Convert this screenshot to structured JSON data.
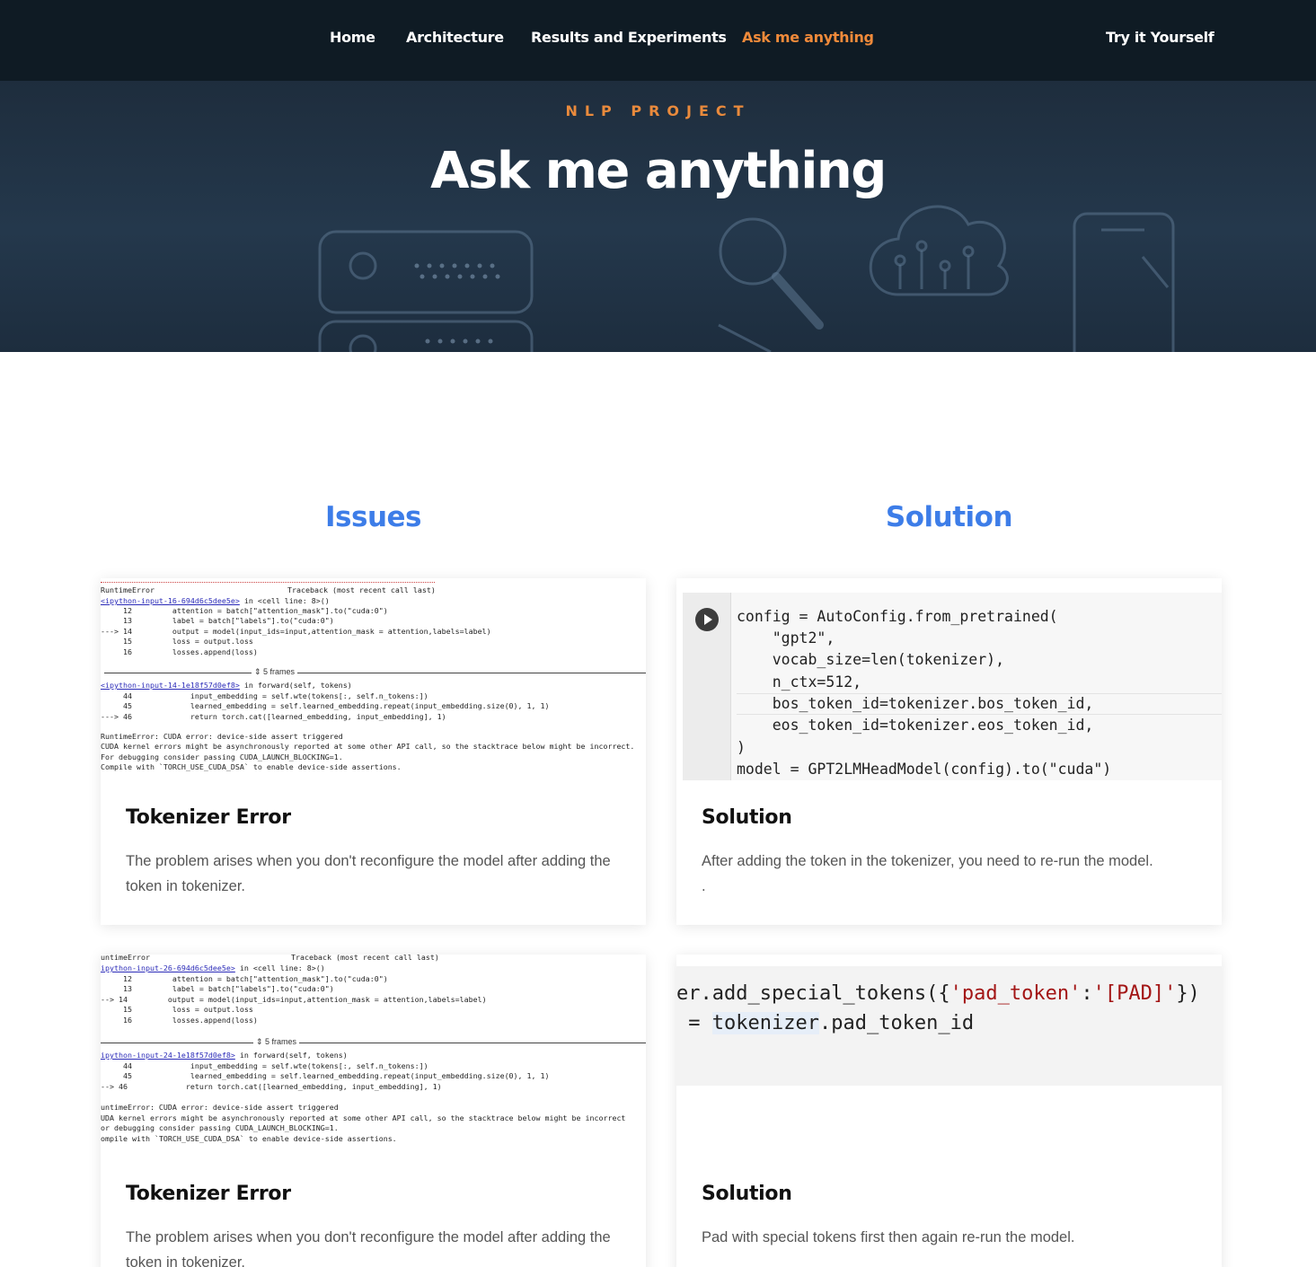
{
  "nav": {
    "links": [
      {
        "label": "Home"
      },
      {
        "label": "Architecture"
      },
      {
        "label": "Results and Experiments"
      },
      {
        "label": "Ask me anything"
      }
    ],
    "cta": "Try it Yourself",
    "active_color": "#f08a3a"
  },
  "hero": {
    "eyebrow": "NLP PROJECT",
    "title": "Ask me anything",
    "decor_icons": [
      "server-icon",
      "magnifier-icon",
      "cloud-circuit-icon",
      "smartphone-icon"
    ]
  },
  "columns": {
    "left_heading": "Issues",
    "right_heading": "Solution",
    "heading_color": "#3d7de8"
  },
  "cards": [
    {
      "title": "Tokenizer Error",
      "text": "The problem arises when you don't reconfigure the model after adding the token in tokenizer.",
      "traceback": {
        "header_left": "RuntimeError",
        "header_right": "Traceback (most recent call last)",
        "frame1_link": "<ipython-input-16-694d6c5dee5e>",
        "frame1_rest": " in <cell line: 8>()",
        "frame1_lines": [
          "     12         attention = batch[\"attention_mask\"].to(\"cuda:0\")",
          "     13         label = batch[\"labels\"].to(\"cuda:0\")",
          "---> 14         output = model(input_ids=input,attention_mask = attention,labels=label)",
          "     15         loss = output.loss",
          "     16         losses.append(loss)"
        ],
        "frames": "5 frames",
        "frame2_link": "<ipython-input-14-1e18f57d0ef8>",
        "frame2_rest": " in forward(self, tokens)",
        "frame2_lines": [
          "     44             input_embedding = self.wte(tokens[:, self.n_tokens:])",
          "     45             learned_embedding = self.learned_embedding.repeat(input_embedding.size(0), 1, 1)",
          "---> 46             return torch.cat([learned_embedding, input_embedding], 1)"
        ],
        "error_lines": [
          "RuntimeError: CUDA error: device-side assert triggered",
          "CUDA kernel errors might be asynchronously reported at some other API call, so the stacktrace below might be incorrect.",
          "For debugging consider passing CUDA_LAUNCH_BLOCKING=1.",
          "Compile with `TORCH_USE_CUDA_DSA` to enable device-side assertions."
        ]
      }
    },
    {
      "title": "Solution",
      "text": "After adding the token in the tokenizer, you need to re-run the model.",
      "text2": ".",
      "code_lines": [
        "config = AutoConfig.from_pretrained(",
        "    \"gpt2\",",
        "    vocab_size=len(tokenizer),",
        "    n_ctx=512,",
        "    bos_token_id=tokenizer.bos_token_id,",
        "    eos_token_id=tokenizer.eos_token_id,",
        ")",
        "model = GPT2LMHeadModel(config).to(\"cuda\")"
      ]
    },
    {
      "title": "Tokenizer Error",
      "text": "The problem arises when you don't reconfigure the model after adding the token in tokenizer.",
      "traceback": {
        "header_left": "untimeError",
        "header_right": "Traceback (most recent call last)",
        "frame1_link": "ipython-input-26-694d6c5dee5e>",
        "frame1_rest": " in <cell line: 8>()",
        "frame1_lines": [
          "     12         attention = batch[\"attention_mask\"].to(\"cuda:0\")",
          "     13         label = batch[\"labels\"].to(\"cuda:0\")",
          "--> 14         output = model(input_ids=input,attention_mask = attention,labels=label)",
          "     15         loss = output.loss",
          "     16         losses.append(loss)"
        ],
        "frames": "5 frames",
        "frame2_link": "ipython-input-24-1e18f57d0ef8>",
        "frame2_rest": " in forward(self, tokens)",
        "frame2_lines": [
          "     44             input_embedding = self.wte(tokens[:, self.n_tokens:])",
          "     45             learned_embedding = self.learned_embedding.repeat(input_embedding.size(0), 1, 1)",
          "--> 46             return torch.cat([learned_embedding, input_embedding], 1)"
        ],
        "error_lines": [
          "untimeError: CUDA error: device-side assert triggered",
          "UDA kernel errors might be asynchronously reported at some other API call, so the stacktrace below might be incorrect",
          "or debugging consider passing CUDA_LAUNCH_BLOCKING=1.",
          "ompile with `TORCH_USE_CUDA_DSA` to enable device-side assertions."
        ]
      }
    },
    {
      "title": "Solution",
      "text": "Pad with special tokens first then again re-run the model.",
      "code_line1_a": "er.add_special_tokens({",
      "code_line1_s1": "'pad_token'",
      "code_line1_b": ":",
      "code_line1_s2": "'[PAD]'",
      "code_line1_c": "})",
      "code_line2_a": " = ",
      "code_line2_h": "tokenizer",
      "code_line2_b": ".pad_token_id"
    }
  ]
}
